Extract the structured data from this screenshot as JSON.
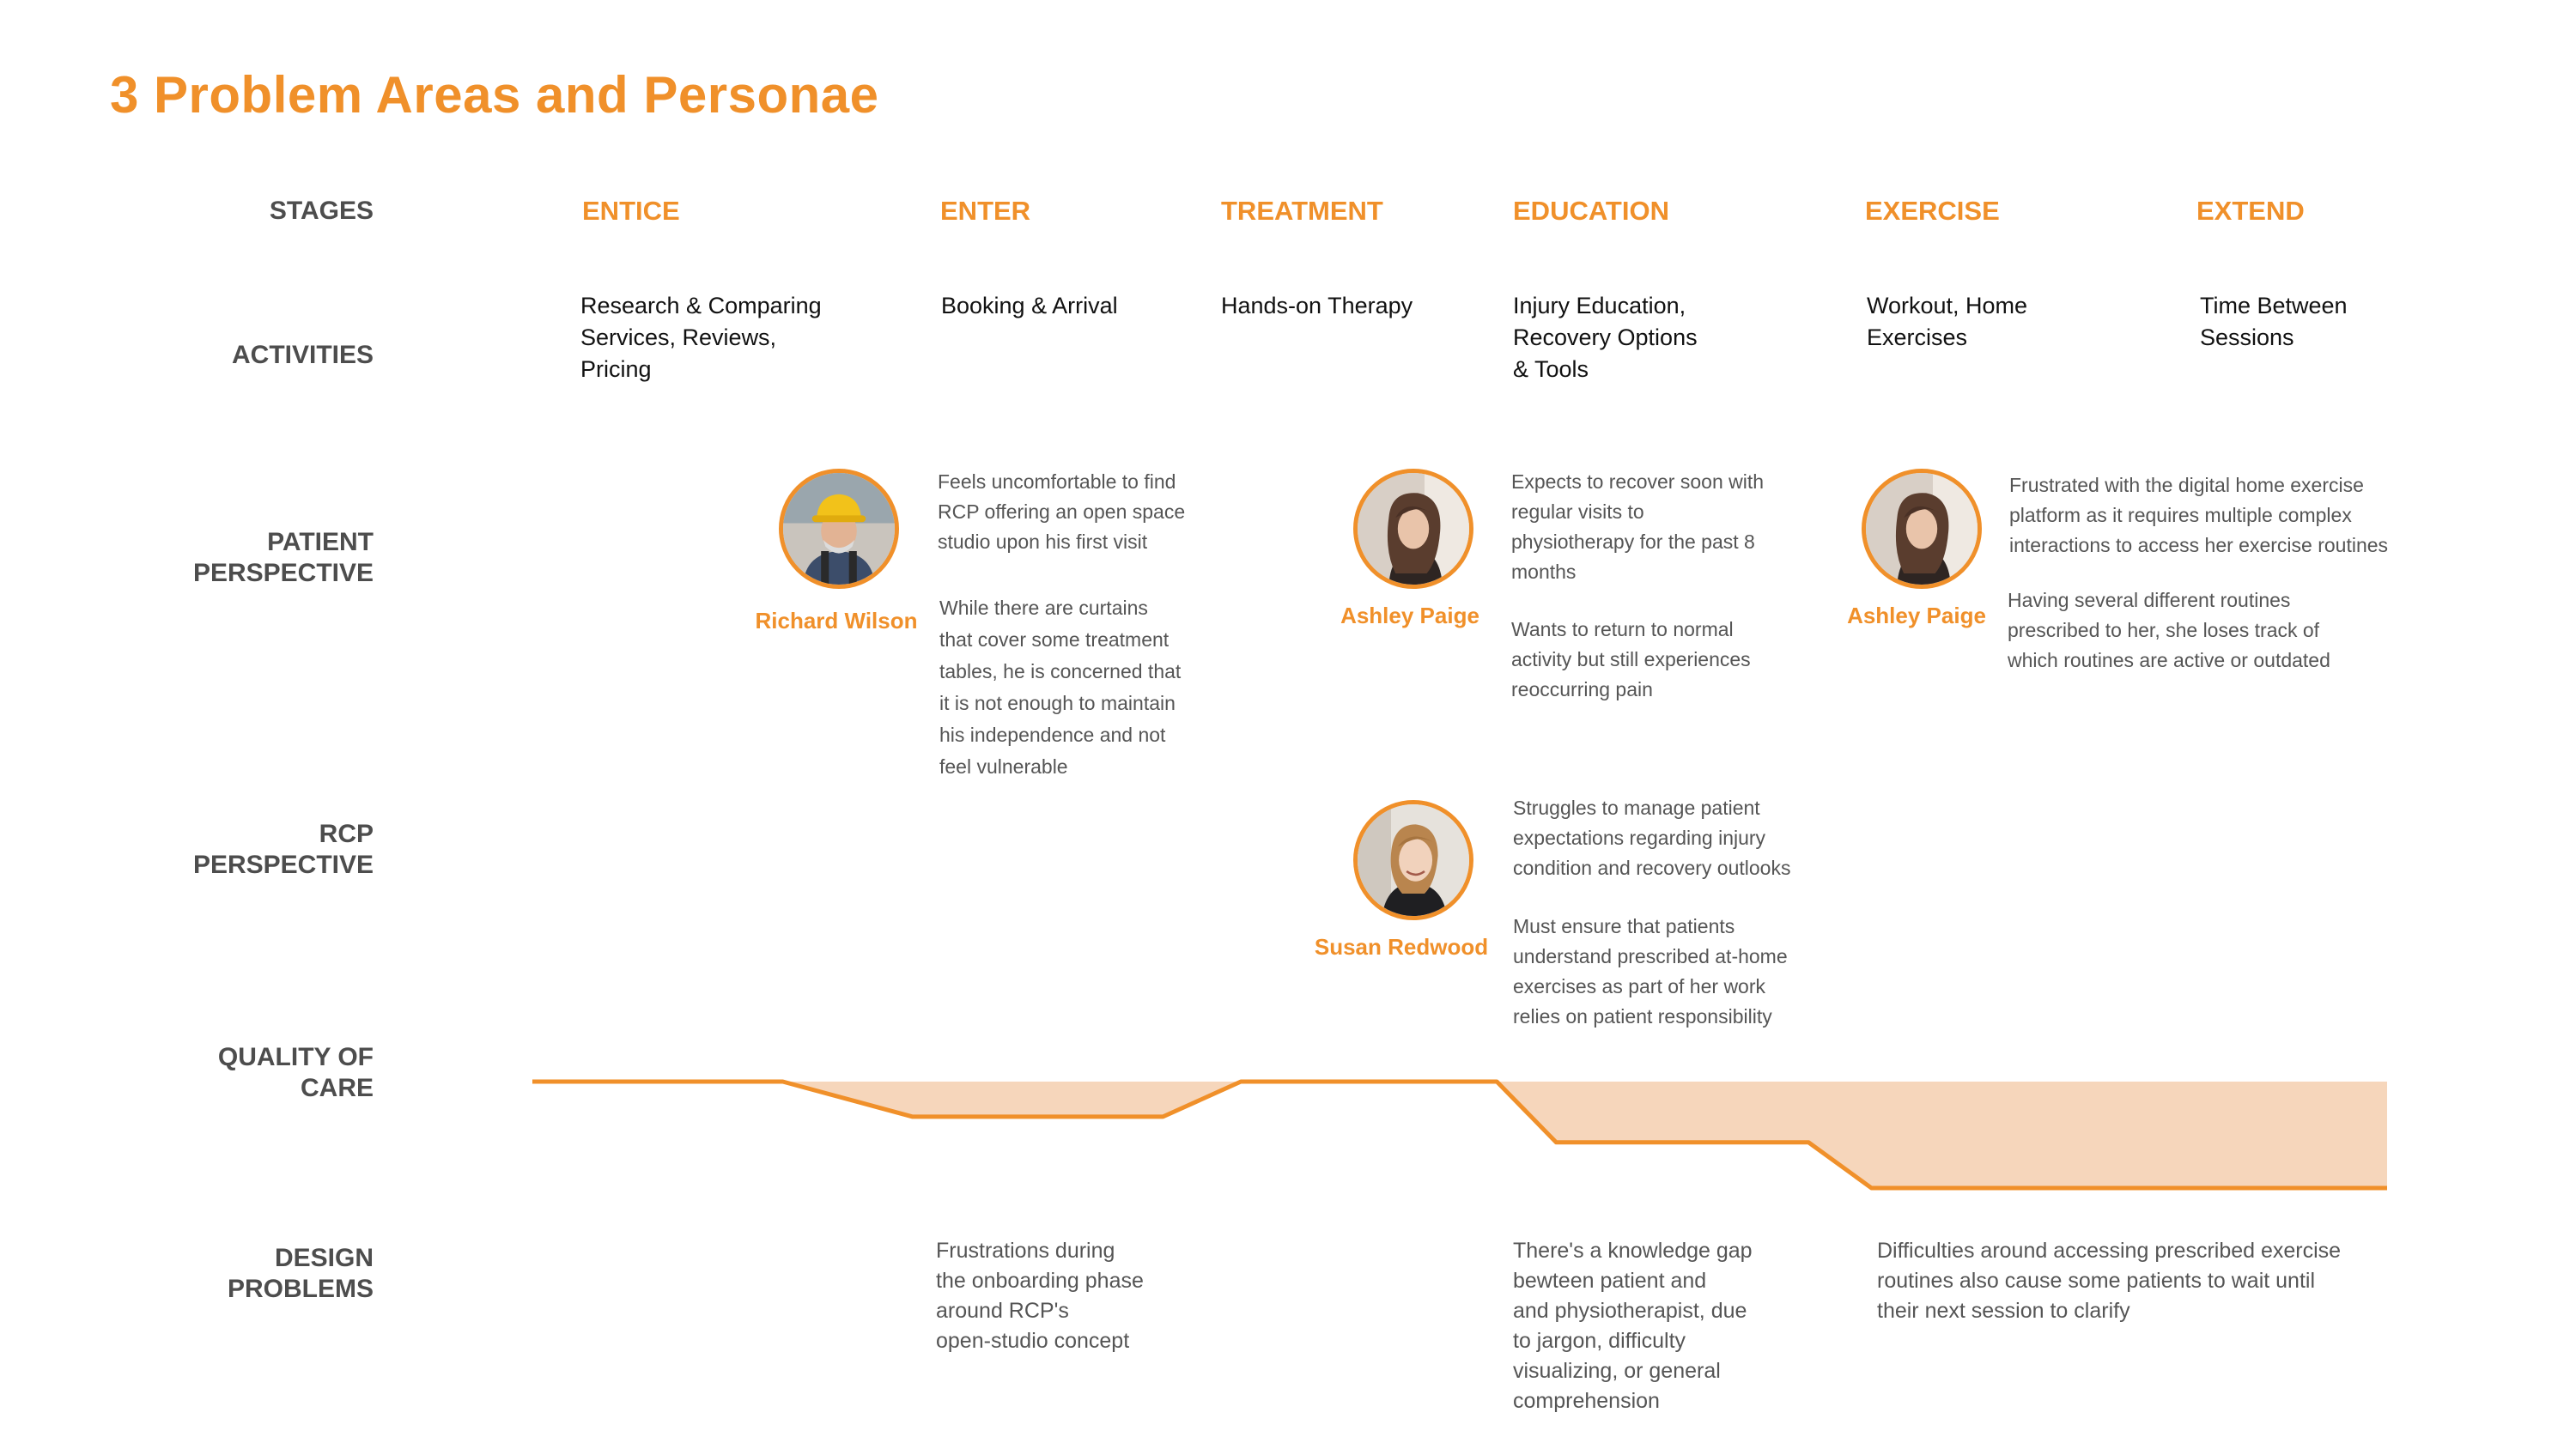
{
  "title": "3 Problem Areas and Personae",
  "row_labels": {
    "stages": "STAGES",
    "activities": "ACTIVITIES",
    "patient_perspective": "PATIENT\nPERSPECTIVE",
    "rcp_perspective": "RCP\nPERSPECTIVE",
    "quality_of_care": "QUALITY OF\nCARE",
    "design_problems": "DESIGN\nPROBLEMS"
  },
  "stages": [
    "ENTICE",
    "ENTER",
    "TREATMENT",
    "EDUCATION",
    "EXERCISE",
    "EXTEND"
  ],
  "activities": [
    "Research & Comparing\nServices, Reviews,\nPricing",
    "Booking & Arrival",
    "Hands-on Therapy",
    "Injury Education,\nRecovery Options\n& Tools",
    "Workout, Home\nExercises",
    "Time Between\nSessions"
  ],
  "patient": {
    "richard": {
      "name": "Richard Wilson",
      "avatar": "construction-worker-icon",
      "text1": "Feels uncomfortable to find\nRCP offering an open space\nstudio upon his first visit",
      "text2": "While there are curtains\nthat cover some treatment\ntables, he is concerned that\nit is not enough to maintain\nhis independence and not\nfeel vulnerable"
    },
    "ashley_education": {
      "name": "Ashley Paige",
      "avatar": "woman-portrait-icon",
      "text1": "Expects to recover soon with\nregular visits to\nphysiotherapy for the past 8\nmonths",
      "text2": "Wants to return to normal\nactivity but still experiences\nreoccurring pain"
    },
    "ashley_exercise": {
      "name": "Ashley Paige",
      "avatar": "woman-portrait-icon",
      "text1": "Frustrated with the digital home exercise\nplatform as it requires multiple complex\ninteractions to access her exercise routines",
      "text2": "Having several different routines\nprescribed to her, she loses track of\nwhich routines are active or outdated"
    }
  },
  "rcp": {
    "susan": {
      "name": "Susan Redwood",
      "avatar": "smiling-woman-portrait-icon",
      "text1": "Struggles to manage patient\nexpectations regarding injury\ncondition and recovery outlooks",
      "text2": "Must ensure that patients\nunderstand prescribed at-home\nexercises  as part of her work\nrelies on patient responsibility"
    }
  },
  "design_problems": [
    "Frustrations during\nthe onboarding phase\naround RCP's\nopen-studio concept",
    "There's a knowledge gap\nbewteen patient and\nand physiotherapist, due\nto jargon, difficulty\nvisualizing, or general\ncomprehension",
    "Difficulties around accessing prescribed exercise\nroutines also cause some patients to wait until\ntheir next session to clarify"
  ],
  "chart_data": {
    "type": "line",
    "series": [
      {
        "x": [
          0,
          0.135,
          0.205,
          0.34,
          0.382,
          0.52,
          0.552,
          0.688,
          0.722,
          1.0
        ],
        "values": [
          1.0,
          1.0,
          0.67,
          0.67,
          1.0,
          1.0,
          0.43,
          0.43,
          0.0,
          0.0
        ]
      }
    ],
    "xlim": [
      0,
      1
    ],
    "ylim": [
      0,
      1
    ],
    "colors": {
      "line": "#f0902a",
      "fill": "#f6d6bb"
    },
    "grid": false,
    "xlabel": "",
    "ylabel": ""
  }
}
